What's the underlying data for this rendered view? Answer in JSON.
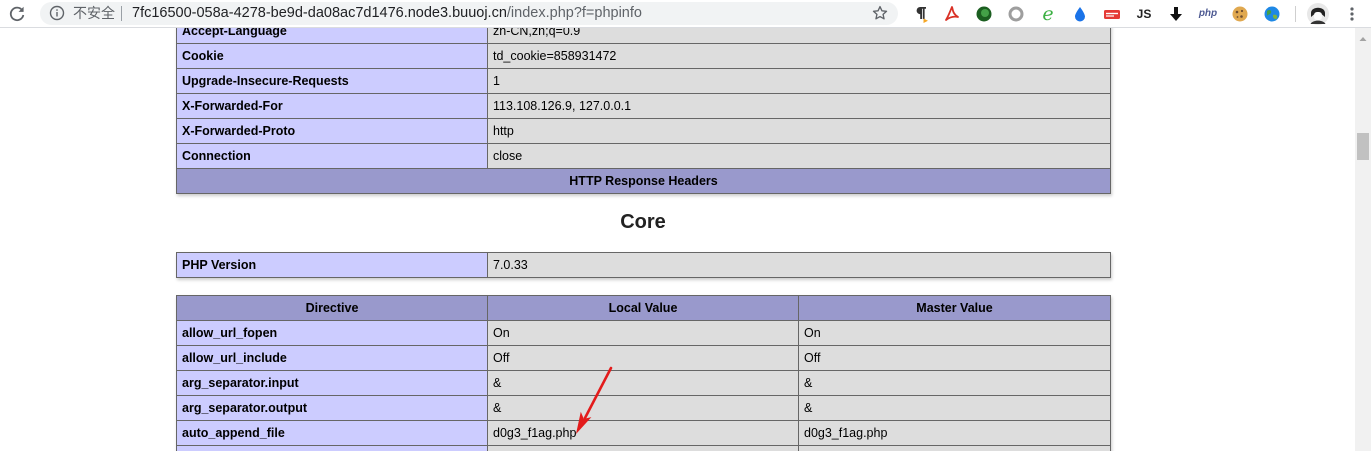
{
  "browser": {
    "security_label": "不安全",
    "url_host": "7fc16500-058a-4278-be9d-da08ac7d1476.node3.buuoj.cn",
    "url_path": "/index.php?f=phpinfo",
    "icons": [
      "reload-icon",
      "info-icon",
      "star-icon",
      "avatar",
      "menu-icon"
    ],
    "extensions": [
      {
        "icon": "paragraph-icon"
      },
      {
        "icon": "pdf-icon"
      },
      {
        "icon": "green-circle-icon"
      },
      {
        "icon": "ring-icon"
      },
      {
        "icon": "e-icon",
        "label": "e"
      },
      {
        "icon": "water-drop-icon"
      },
      {
        "icon": "red-tag-icon"
      },
      {
        "icon": "js-icon",
        "label": "JS"
      },
      {
        "icon": "download-arrow-icon"
      },
      {
        "icon": "php-icon",
        "label": "php"
      },
      {
        "icon": "cookie-icon"
      },
      {
        "icon": "globe-icon"
      }
    ]
  },
  "request_headers": [
    {
      "name": "Accept-Language",
      "value": "zh-CN,zh;q=0.9"
    },
    {
      "name": "Cookie",
      "value": "td_cookie=858931472"
    },
    {
      "name": "Upgrade-Insecure-Requests",
      "value": "1"
    },
    {
      "name": "X-Forwarded-For",
      "value": "113.108.126.9, 127.0.0.1"
    },
    {
      "name": "X-Forwarded-Proto",
      "value": "http"
    },
    {
      "name": "Connection",
      "value": "close"
    }
  ],
  "response_headers": {
    "title": "HTTP Response Headers"
  },
  "core": {
    "title": "Core",
    "php_version_label": "PHP Version",
    "php_version": "7.0.33",
    "columns": [
      "Directive",
      "Local Value",
      "Master Value"
    ],
    "directives": [
      {
        "name": "allow_url_fopen",
        "local": "On",
        "master": "On"
      },
      {
        "name": "allow_url_include",
        "local": "Off",
        "master": "Off"
      },
      {
        "name": "arg_separator.input",
        "local": "&",
        "master": "&"
      },
      {
        "name": "arg_separator.output",
        "local": "&",
        "master": "&"
      },
      {
        "name": "auto_append_file",
        "local": "d0g3_f1ag.php",
        "master": "d0g3_f1ag.php"
      }
    ]
  },
  "colors": {
    "entry": "#ccccff",
    "header": "#9999cc",
    "value": "#dddddd",
    "border": "#666666",
    "annotation": "#e31b1b",
    "omnibox": "#f1f3f4"
  }
}
